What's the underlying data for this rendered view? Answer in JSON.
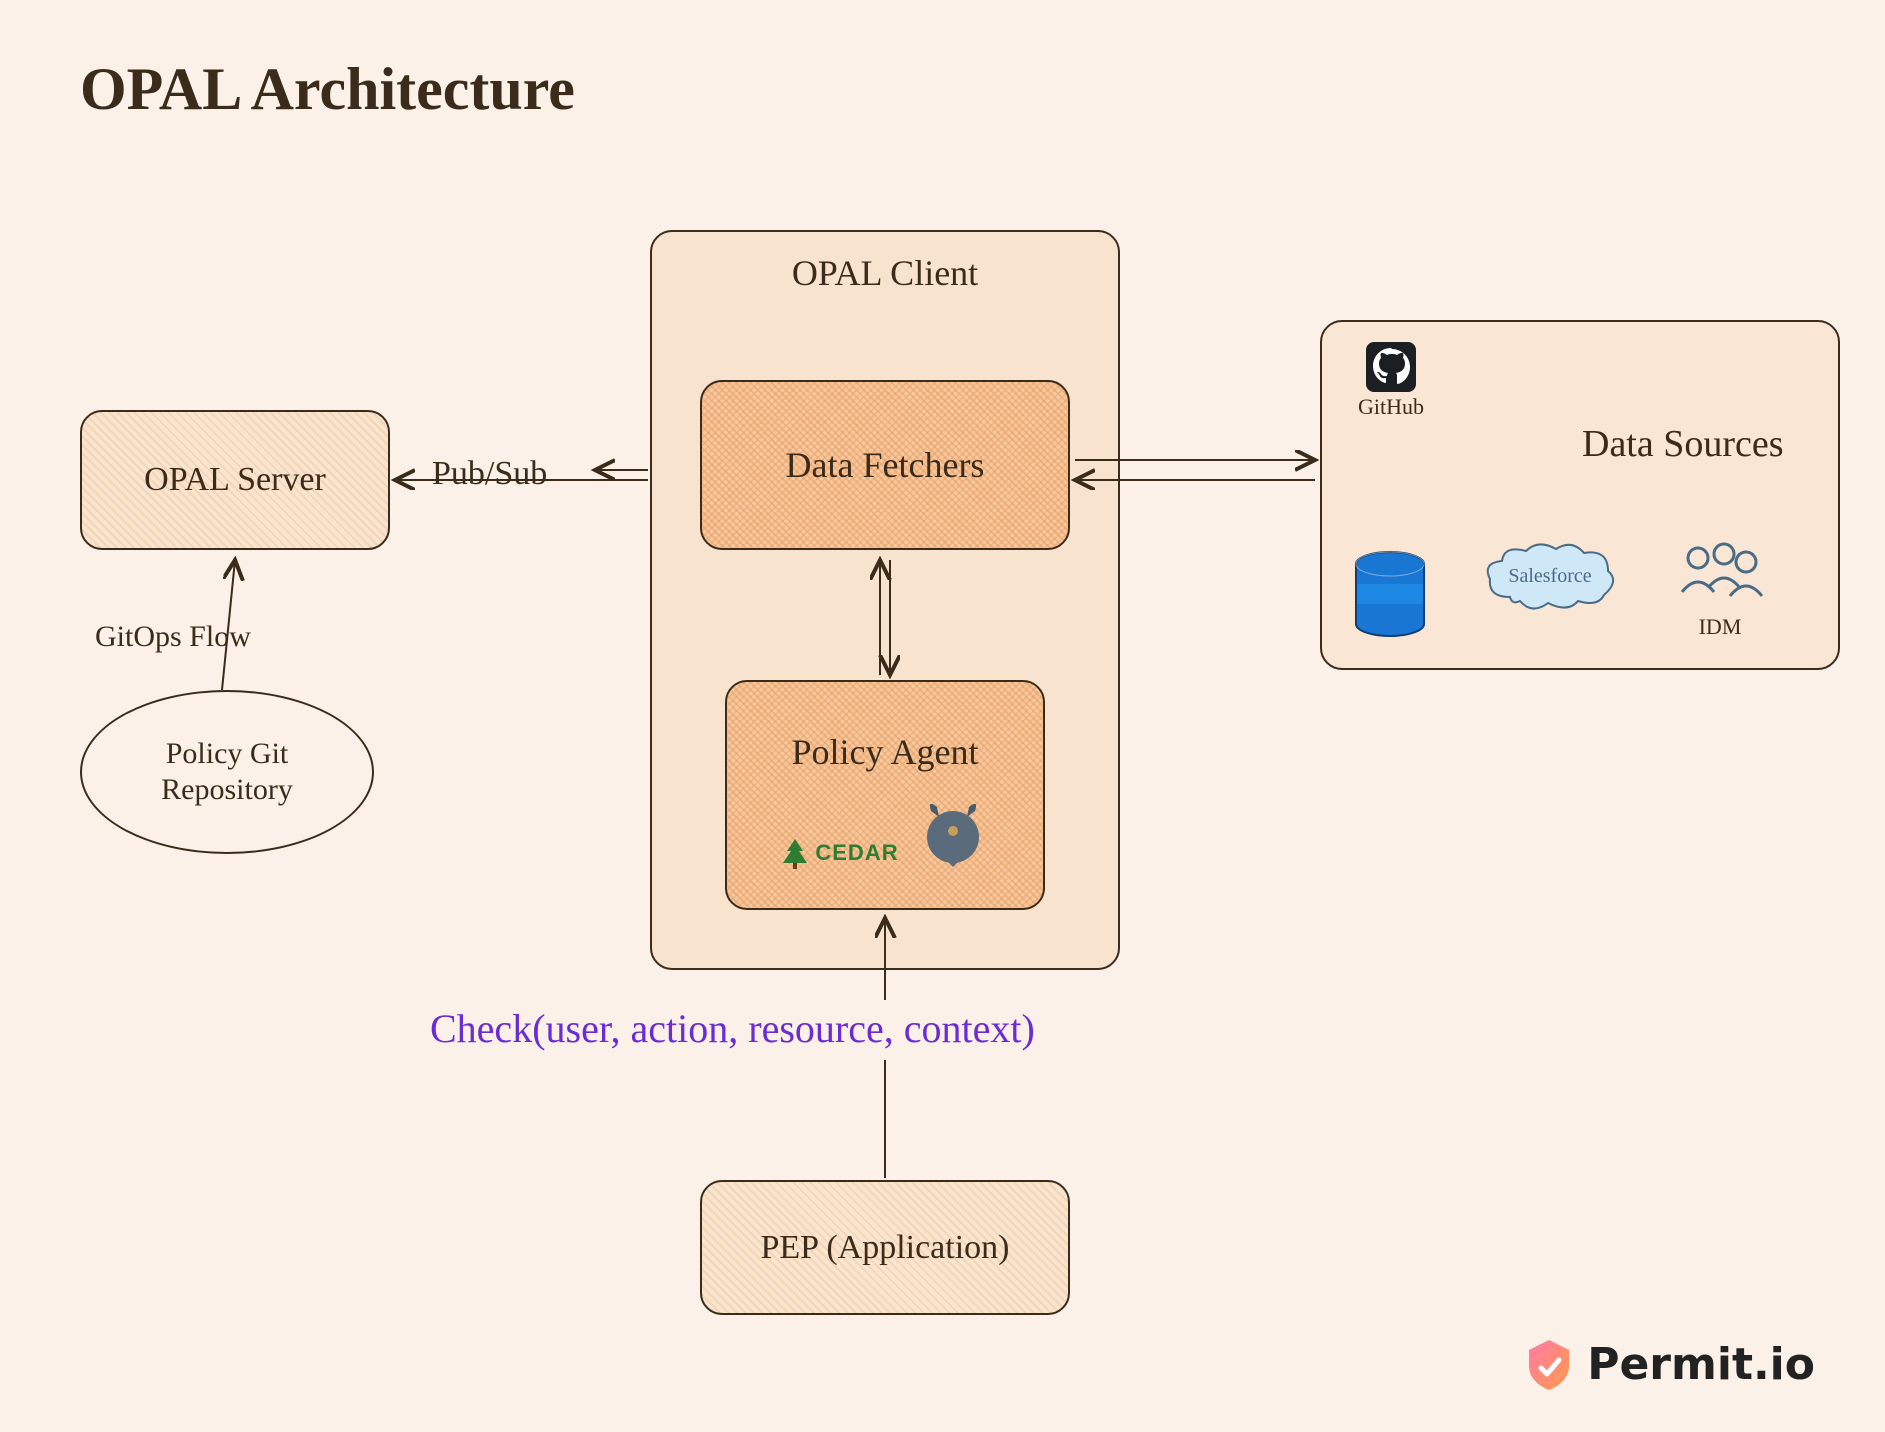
{
  "title": "OPAL Architecture",
  "opal_server": {
    "label": "OPAL Server"
  },
  "policy_git": {
    "label": "Policy Git\nRepository"
  },
  "gitops_flow": "GitOps Flow",
  "pub_sub": "Pub/Sub",
  "opal_client": {
    "label": "OPAL Client",
    "data_fetchers": "Data Fetchers",
    "policy_agent": {
      "label": "Policy Agent",
      "cedar": "CEDAR",
      "opa_icon": "opa-viking-icon"
    }
  },
  "data_sources": {
    "label": "Data Sources",
    "github": "GitHub",
    "database_icon": "database-icon",
    "salesforce": "Salesforce",
    "idm": "IDM"
  },
  "check_call": "Check(user, action, resource, context)",
  "pep": {
    "label": "PEP (Application)"
  },
  "branding": {
    "name": "Permit.io"
  }
}
